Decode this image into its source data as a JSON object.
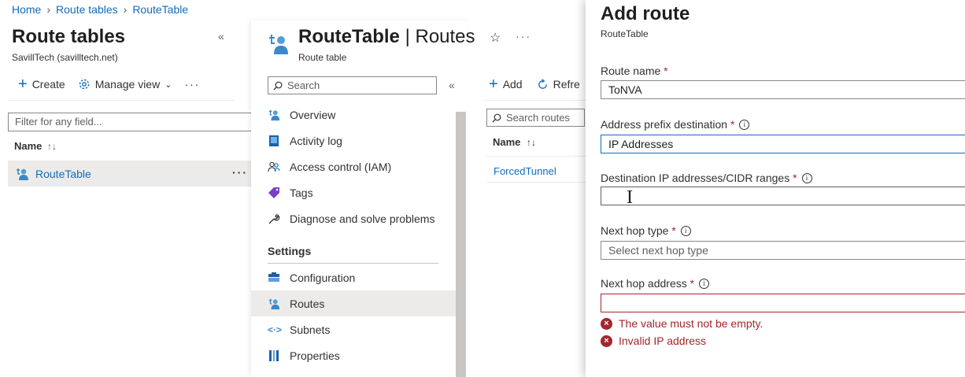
{
  "breadcrumb": [
    "Home",
    "Route tables",
    "RouteTable"
  ],
  "left": {
    "title": "Route tables",
    "subtitle": "SavillTech (savilltech.net)",
    "create_label": "Create",
    "manage_view_label": "Manage view",
    "filter_placeholder": "Filter for any field...",
    "column_name": "Name",
    "sort_icon": "↑↓",
    "rows": [
      {
        "name": "RouteTable"
      }
    ]
  },
  "middle": {
    "title": "RouteTable",
    "title_suffix": "| Routes",
    "subtitle": "Route table",
    "search_placeholder": "Search",
    "menu": [
      {
        "label": "Overview",
        "icon": "route-table-icon"
      },
      {
        "label": "Activity log",
        "icon": "activity-log-icon"
      },
      {
        "label": "Access control (IAM)",
        "icon": "people-icon"
      },
      {
        "label": "Tags",
        "icon": "tag-icon"
      },
      {
        "label": "Diagnose and solve problems",
        "icon": "wrench-icon"
      }
    ],
    "settings_heading": "Settings",
    "settings_menu": [
      {
        "label": "Configuration",
        "icon": "configuration-icon"
      },
      {
        "label": "Routes",
        "icon": "route-table-icon",
        "active": true
      },
      {
        "label": "Subnets",
        "icon": "subnet-icon"
      },
      {
        "label": "Properties",
        "icon": "properties-icon"
      }
    ]
  },
  "routes": {
    "add_label": "Add",
    "refresh_label": "Refre",
    "search_placeholder": "Search routes",
    "column_name": "Name",
    "sort_icon": "↑↓",
    "rows": [
      {
        "name": "ForcedTunnel"
      }
    ]
  },
  "add_route": {
    "title": "Add route",
    "subtitle": "RouteTable",
    "route_name_label": "Route name",
    "route_name_value": "ToNVA",
    "address_prefix_label": "Address prefix destination",
    "address_prefix_value": "IP Addresses",
    "dest_ip_label": "Destination IP addresses/CIDR ranges",
    "dest_ip_value": "",
    "next_hop_type_label": "Next hop type",
    "next_hop_type_placeholder": "Select next hop type",
    "next_hop_address_label": "Next hop address",
    "next_hop_address_value": "",
    "errors": [
      "The value must not be empty.",
      "Invalid IP address"
    ],
    "required_mark": "*",
    "info_mark": "i"
  },
  "colors": {
    "link": "#0f6cbd",
    "error": "#a4262c",
    "selected_row": "#edebe9"
  }
}
